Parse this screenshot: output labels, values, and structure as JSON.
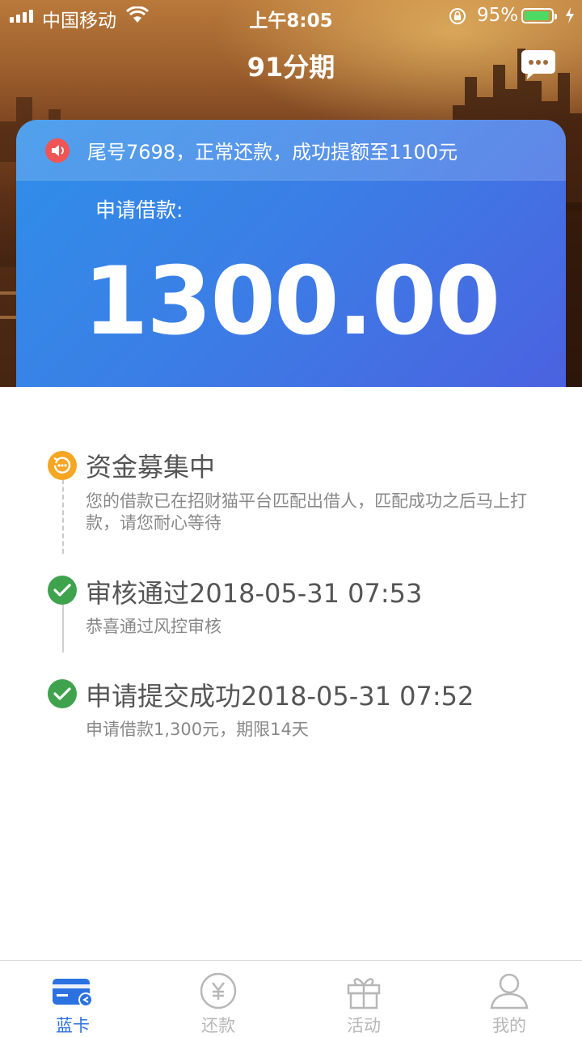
{
  "status_bar": {
    "carrier": "中国移动",
    "time": "上午8:05",
    "battery_percent": "95%",
    "battery_level": 0.95
  },
  "header": {
    "title": "91分期",
    "message_icon": "chat-bubble-icon"
  },
  "card": {
    "notice": "尾号7698，正常还款，成功提额至1100元",
    "notice_icon": "speaker-icon",
    "apply_label": "申请借款:",
    "amount": "1300.00"
  },
  "timeline": {
    "steps": [
      {
        "title": "资金募集中",
        "description": "您的借款已在招财猫平台匹配出借人，匹配成功之后马上打款，请您耐心等待",
        "icon": "pending-clock-icon",
        "color": "#f5a623"
      },
      {
        "title": "审核通过2018-05-31 07:53",
        "description": "恭喜通过风控审核",
        "icon": "check-icon",
        "color": "#3fa34d"
      },
      {
        "title": "申请提交成功2018-05-31 07:52",
        "description": "申请借款1,300元，期限14天",
        "icon": "check-icon",
        "color": "#3fa34d"
      }
    ]
  },
  "tabbar": {
    "tabs": [
      {
        "label": "蓝卡",
        "icon": "card-icon",
        "active": true
      },
      {
        "label": "还款",
        "icon": "yuan-coin-icon",
        "active": false
      },
      {
        "label": "活动",
        "icon": "gift-icon",
        "active": false
      },
      {
        "label": "我的",
        "icon": "user-icon",
        "active": false
      }
    ],
    "active_color": "#2b72e0",
    "inactive_color": "#b7b7b7"
  }
}
